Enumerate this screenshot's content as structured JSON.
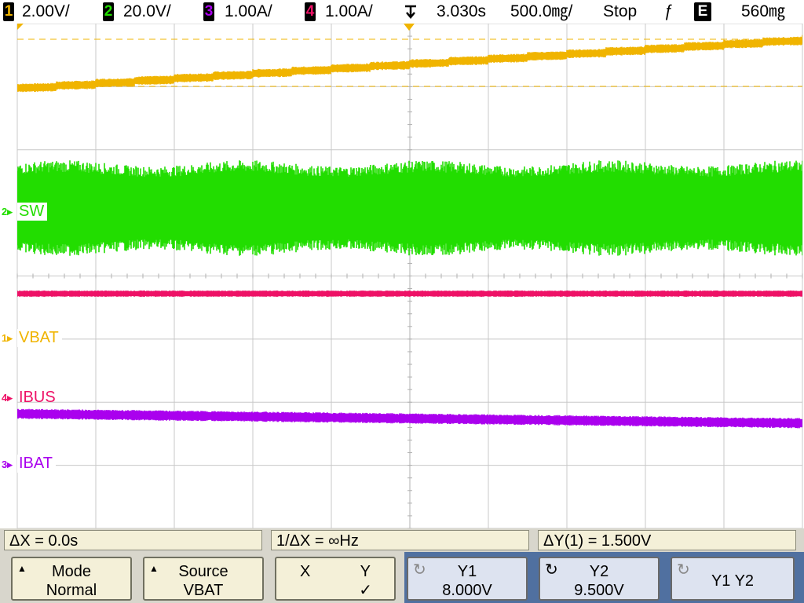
{
  "topbar": {
    "ch1_num": "1",
    "ch1_scale": "2.00V/",
    "ch2_num": "2",
    "ch2_scale": "20.0V/",
    "ch3_num": "3",
    "ch3_scale": "1.00A/",
    "ch4_num": "4",
    "ch4_scale": "1.00A/",
    "delay": "3.030s",
    "timebase": "500.0㎎/",
    "run_state": "Stop",
    "trigger_glyph": "ƒ",
    "trigger_mode": "E",
    "trigger_level": "560㎎"
  },
  "waveform": {
    "traces": [
      {
        "name": "SW",
        "channel": "2",
        "color": "#22dd00"
      },
      {
        "name": "VBAT",
        "channel": "1",
        "color": "#f0b400"
      },
      {
        "name": "IBUS",
        "channel": "4",
        "color": "#ee1166"
      },
      {
        "name": "IBAT",
        "channel": "3",
        "color": "#aa00ee"
      }
    ]
  },
  "info": {
    "delta_x": "ΔX = 0.0s",
    "inv_delta_x": "1/ΔX = ∞Hz",
    "delta_y": "ΔY(1) = 1.500V"
  },
  "softkeys": {
    "mode_label": "Mode",
    "mode_value": "Normal",
    "source_label": "Source",
    "source_value": "VBAT",
    "x_label": "X",
    "y_label": "Y",
    "xy_check": "✓",
    "y1_label": "Y1",
    "y1_value": "8.000V",
    "y2_label": "Y2",
    "y2_value": "9.500V",
    "y1y2_label": "Y1 Y2"
  },
  "colors": {
    "ch1": "#f0b400",
    "ch2": "#22dd00",
    "ch3": "#aa00ee",
    "ch4": "#ee1166",
    "softkey_bg": "#f4f0d8",
    "active_key_panel": "#5070a0"
  },
  "icons": [
    "trigger-position-icon",
    "trigger-slope-icon",
    "ground-marker-icon",
    "knob-icon"
  ]
}
